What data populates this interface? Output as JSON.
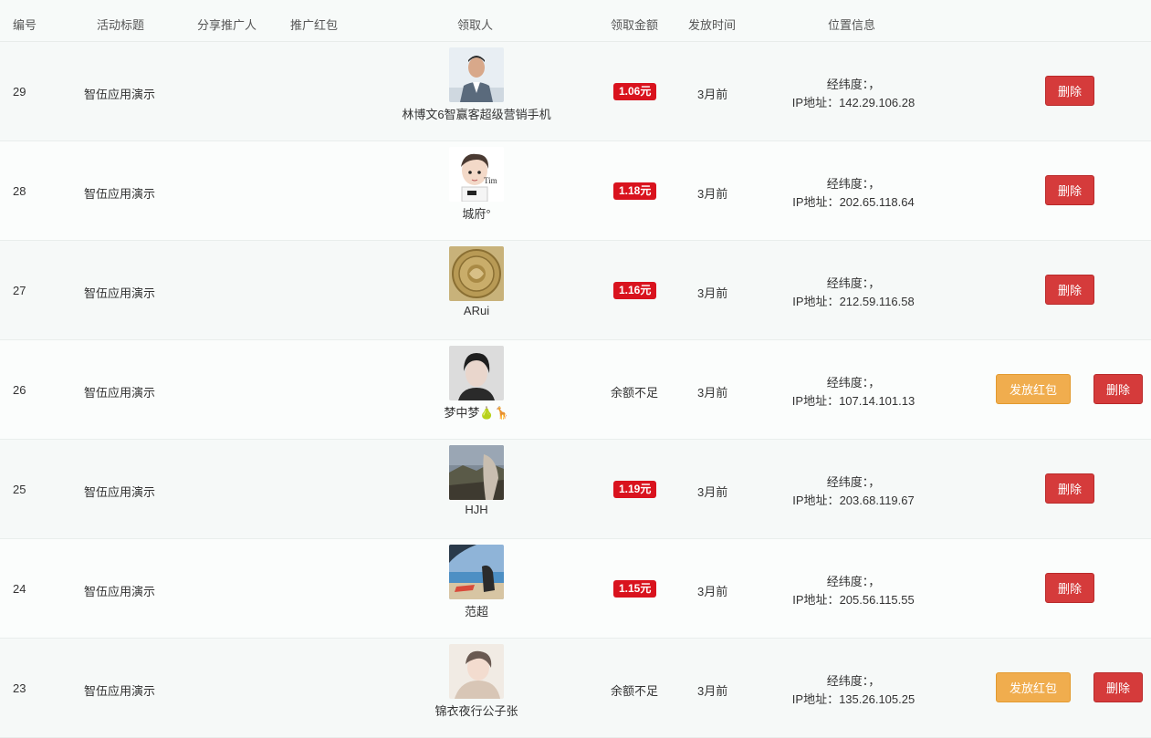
{
  "columns": {
    "id": "编号",
    "title": "活动标题",
    "sharer": "分享推广人",
    "redpack": "推广红包",
    "receiver": "领取人",
    "amount": "领取金额",
    "time": "发放时间",
    "location": "位置信息"
  },
  "labels": {
    "latlng": "经纬度：，",
    "ip_prefix": "IP地址：",
    "delete": "删除",
    "send": "发放红包"
  },
  "colors": {
    "badge": "#d9131e",
    "delete": "#d53b3b",
    "send": "#f0ad4e"
  },
  "rows": [
    {
      "id": "29",
      "title": "智伍应用演示",
      "nick": "林博文6智赢客超级营销手机",
      "amount": "1.06元",
      "amount_type": "badge",
      "time": "3月前",
      "ip": "142.29.106.28",
      "send": false,
      "avatar": "avatar-man-suit"
    },
    {
      "id": "28",
      "title": "智伍应用演示",
      "nick": "城府°",
      "amount": "1.18元",
      "amount_type": "badge",
      "time": "3月前",
      "ip": "202.65.118.64",
      "send": false,
      "avatar": "avatar-cartoon"
    },
    {
      "id": "27",
      "title": "智伍应用演示",
      "nick": "ARui",
      "amount": "1.16元",
      "amount_type": "badge",
      "time": "3月前",
      "ip": "212.59.116.58",
      "send": false,
      "avatar": "avatar-coin"
    },
    {
      "id": "26",
      "title": "智伍应用演示",
      "nick": "梦中梦🍐🦒",
      "amount": "余额不足",
      "amount_type": "text",
      "time": "3月前",
      "ip": "107.14.101.13",
      "send": true,
      "avatar": "avatar-portrait"
    },
    {
      "id": "25",
      "title": "智伍应用演示",
      "nick": "HJH",
      "amount": "1.19元",
      "amount_type": "badge",
      "time": "3月前",
      "ip": "203.68.119.67",
      "send": false,
      "avatar": "avatar-landscape"
    },
    {
      "id": "24",
      "title": "智伍应用演示",
      "nick": "范超",
      "amount": "1.15元",
      "amount_type": "badge",
      "time": "3月前",
      "ip": "205.56.115.55",
      "send": false,
      "avatar": "avatar-beach"
    },
    {
      "id": "23",
      "title": "智伍应用演示",
      "nick": "锦衣夜行公子张",
      "amount": "余额不足",
      "amount_type": "text",
      "time": "3月前",
      "ip": "135.26.105.25",
      "send": true,
      "avatar": "avatar-girl"
    }
  ]
}
